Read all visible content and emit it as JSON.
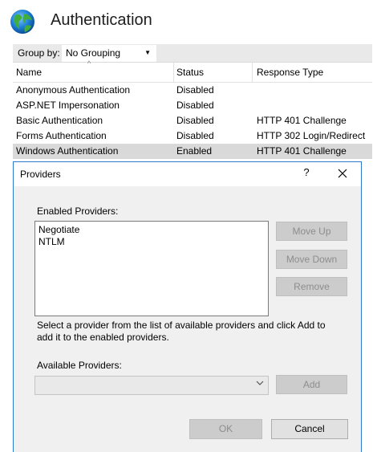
{
  "page": {
    "title": "Authentication"
  },
  "toolbar": {
    "group_by_label": "Group by:",
    "group_by_value": "No Grouping"
  },
  "grid": {
    "columns": [
      "Name",
      "Status",
      "Response Type"
    ],
    "rows": [
      {
        "name": "Anonymous Authentication",
        "status": "Disabled",
        "response": ""
      },
      {
        "name": "ASP.NET Impersonation",
        "status": "Disabled",
        "response": ""
      },
      {
        "name": "Basic Authentication",
        "status": "Disabled",
        "response": "HTTP 401 Challenge"
      },
      {
        "name": "Forms Authentication",
        "status": "Disabled",
        "response": "HTTP 302 Login/Redirect"
      },
      {
        "name": "Windows Authentication",
        "status": "Enabled",
        "response": "HTTP 401 Challenge",
        "selected": true
      }
    ]
  },
  "dialog": {
    "title": "Providers",
    "help": "?",
    "enabled_label": "Enabled Providers:",
    "enabled_providers": [
      "Negotiate",
      "NTLM"
    ],
    "move_up": "Move Up",
    "move_down": "Move Down",
    "remove": "Remove",
    "hint": "Select a provider from the list of available providers and click Add to add it to the enabled providers.",
    "available_label": "Available Providers:",
    "available_value": "",
    "add": "Add",
    "ok": "OK",
    "cancel": "Cancel"
  },
  "colors": {
    "accent_border": "#2b79d0",
    "selected_row": "#d9d9d9",
    "toolbar": "#e9e9e9"
  }
}
